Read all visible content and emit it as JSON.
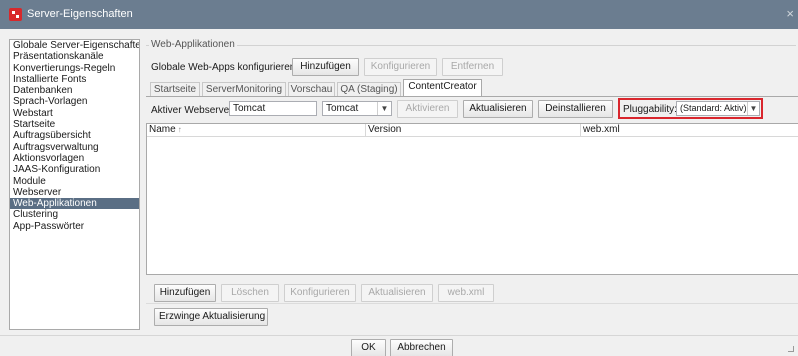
{
  "window": {
    "title": "Server-Eigenschaften",
    "close_glyph": "×"
  },
  "sidebar": {
    "items": [
      {
        "label": "Globale Server-Eigenschaften"
      },
      {
        "label": "Präsentationskanäle"
      },
      {
        "label": "Konvertierungs-Regeln"
      },
      {
        "label": "Installierte Fonts"
      },
      {
        "label": "Datenbanken"
      },
      {
        "label": "Sprach-Vorlagen"
      },
      {
        "label": "Webstart"
      },
      {
        "label": "Startseite"
      },
      {
        "label": "Auftragsübersicht"
      },
      {
        "label": "Auftragsverwaltung"
      },
      {
        "label": "Aktionsvorlagen"
      },
      {
        "label": "JAAS-Konfiguration"
      },
      {
        "label": "Module"
      },
      {
        "label": "Webserver"
      },
      {
        "label": "Web-Applikationen",
        "selected": true
      },
      {
        "label": "Clustering"
      },
      {
        "label": "App-Passwörter"
      }
    ]
  },
  "group": {
    "title": "Web-Applikationen"
  },
  "global_webapps": {
    "label": "Globale Web-Apps konfigurieren:",
    "add": "Hinzufügen",
    "configure": "Konfigurieren",
    "remove": "Entfernen"
  },
  "tabs": [
    {
      "label": "Startseite"
    },
    {
      "label": "ServerMonitoring"
    },
    {
      "label": "Vorschau"
    },
    {
      "label": "QA (Staging)"
    },
    {
      "label": "ContentCreator",
      "active": true
    }
  ],
  "webserver_row": {
    "label": "Aktiver Webserver:",
    "name_value": "Tomcat",
    "select_value": "Tomcat",
    "activate": "Aktivieren",
    "update": "Aktualisieren",
    "uninstall": "Deinstallieren",
    "pluggability_label": "Pluggability:",
    "pluggability_value": "(Standard: Aktiv)",
    "highlight_color": "#d9262d"
  },
  "table": {
    "columns": [
      {
        "label": "Name",
        "sort": "↑"
      },
      {
        "label": "Version"
      },
      {
        "label": "web.xml"
      }
    ],
    "rows": []
  },
  "table_actions": {
    "add": "Hinzufügen",
    "delete": "Löschen",
    "configure": "Konfigurieren",
    "update": "Aktualisieren",
    "webxml": "web.xml"
  },
  "force_update": "Erzwinge Aktualisierung",
  "dialog": {
    "ok": "OK",
    "cancel": "Abbrechen"
  },
  "icons": {
    "app": "firstspirit-app-icon",
    "dropdown": "chevron-down-icon",
    "resize": "resize-grip-icon"
  }
}
